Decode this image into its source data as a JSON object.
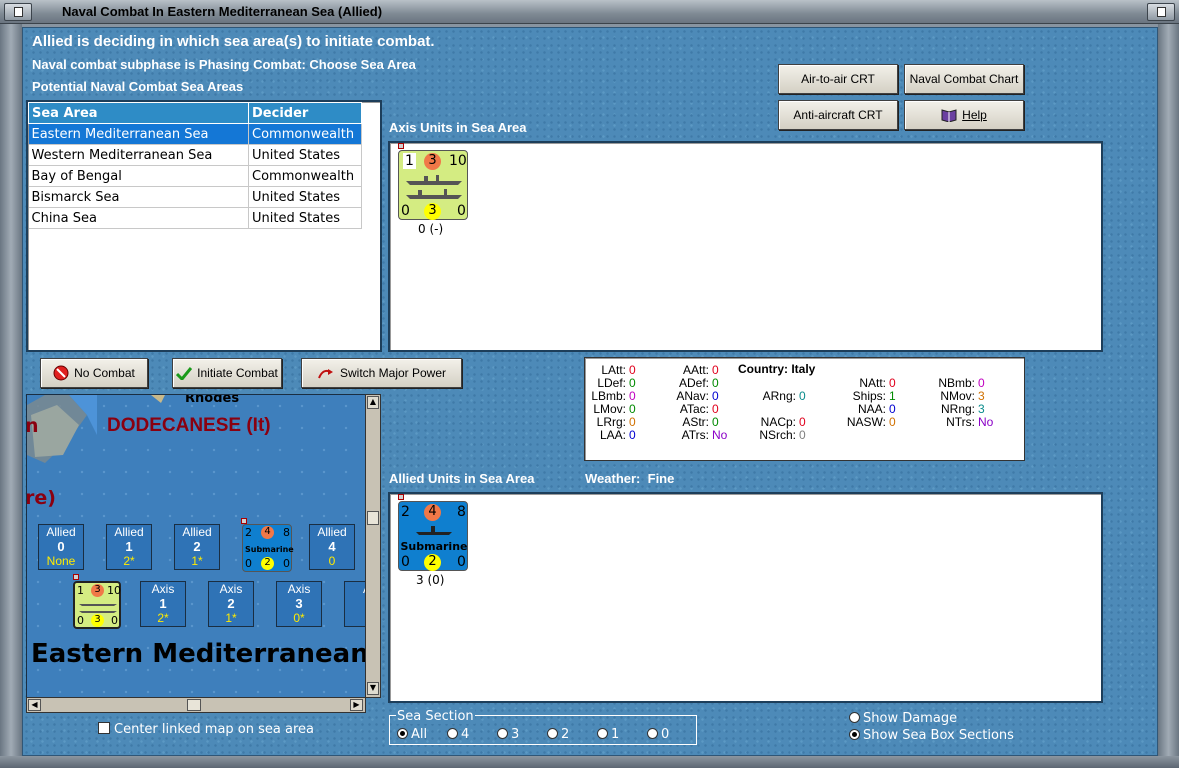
{
  "window": {
    "title": "Naval Combat In Eastern Mediterranean Sea (Allied)"
  },
  "header": {
    "line1": "Allied is deciding in which sea area(s) to initiate combat.",
    "line2": "Naval combat subphase is Phasing Combat: Choose Sea Area",
    "line3": "Potential Naval Combat Sea Areas"
  },
  "sea_table": {
    "columns": [
      "Sea Area",
      "Decider"
    ],
    "rows": [
      [
        "Eastern Mediterranean Sea",
        "Commonwealth"
      ],
      [
        "Western Mediterranean Sea",
        "United States"
      ],
      [
        "Bay of Bengal",
        "Commonwealth"
      ],
      [
        "Bismarck Sea",
        "United States"
      ],
      [
        "China Sea",
        "United States"
      ]
    ],
    "selected": 0
  },
  "buttons": {
    "air_to_air": "Air-to-air CRT",
    "naval_chart": "Naval Combat Chart",
    "anti_aircraft": "Anti-aircraft CRT",
    "help": "Help",
    "no_combat": "No Combat",
    "initiate": "Initiate Combat",
    "switch": "Switch Major Power"
  },
  "axis": {
    "label": "Axis Units in Sea Area",
    "unit": {
      "top_left": "1",
      "top_mid": "3",
      "top_right": "10",
      "bot_left": "0",
      "bot_mid": "3",
      "bot_right": "0",
      "caption": "0 (-)"
    }
  },
  "allied": {
    "label": "Allied Units in Sea Area",
    "weather_label": "Weather:",
    "weather": "Fine",
    "unit": {
      "top_left": "2",
      "top_mid": "4",
      "top_right": "8",
      "name": "Submarine",
      "bot_left": "0",
      "bot_mid": "2",
      "bot_right": "0",
      "caption": "3 (0)"
    }
  },
  "stats": {
    "country_label": "Country:",
    "country": "Italy",
    "col1": [
      [
        "LAtt:",
        "0"
      ],
      [
        "LDef:",
        "0"
      ],
      [
        "LBmb:",
        "0"
      ],
      [
        "LMov:",
        "0"
      ],
      [
        "LRrg:",
        "0"
      ],
      [
        "LAA:",
        "0"
      ]
    ],
    "col2": [
      [
        "AAtt:",
        "0"
      ],
      [
        "ADef:",
        "0"
      ],
      [
        "ANav:",
        "0"
      ],
      [
        "ATac:",
        "0"
      ],
      [
        "AStr:",
        "0"
      ],
      [
        "ATrs:",
        "No"
      ]
    ],
    "col3": [
      [
        "ARng:",
        "0"
      ],
      [
        "NACp:",
        "0"
      ],
      [
        "NSrch:",
        "0"
      ]
    ],
    "col4": [
      [
        "NAtt:",
        "0"
      ],
      [
        "Ships:",
        "1"
      ],
      [
        "NAA:",
        "0"
      ],
      [
        "NASW:",
        "0"
      ]
    ],
    "col5": [
      [
        "NBmb:",
        "0"
      ],
      [
        "NMov:",
        "3"
      ],
      [
        "NRng:",
        "3"
      ],
      [
        "NTrs:",
        "No"
      ]
    ]
  },
  "colors": {
    "zero": "#e0001c",
    "magenta": "#c000c0",
    "blue": "#0000d0",
    "green": "#008a00",
    "teal": "#0a8c8c",
    "orange": "#d07000",
    "gray": "#808080",
    "purple": "#8a00c8"
  },
  "map": {
    "region": "DODECANESE (It)",
    "island": "Rhodes",
    "partial": "re)",
    "partial_left": "n",
    "sea_name": "Eastern Mediterranean",
    "allied_boxes": [
      {
        "label": "Allied",
        "num": "0",
        "sub": "None"
      },
      {
        "label": "Allied",
        "num": "1",
        "sub": "2*"
      },
      {
        "label": "Allied",
        "num": "2",
        "sub": "1*"
      },
      {
        "label": "Allied",
        "num": "4",
        "sub": "0"
      }
    ],
    "axis_boxes": [
      {
        "label": "Axis",
        "num": "1",
        "sub": "2*"
      },
      {
        "label": "Axis",
        "num": "2",
        "sub": "1*"
      },
      {
        "label": "Axis",
        "num": "3",
        "sub": "0*"
      },
      {
        "label": "A"
      }
    ],
    "sub_counter": {
      "tl": "2",
      "tm": "4",
      "tr": "8",
      "name": "Submarine",
      "bl": "0",
      "bm": "2",
      "br": "0"
    },
    "axis_counter": {
      "tl": "1",
      "tm": "3",
      "tr": "10",
      "bl": "0",
      "bm": "3",
      "br": "0"
    }
  },
  "options": {
    "center_map": "Center linked map on sea area",
    "sea_section_label": "Sea Section",
    "sections": [
      "All",
      "4",
      "3",
      "2",
      "1",
      "0"
    ],
    "show_damage": "Show Damage",
    "show_sections": "Show Sea Box Sections"
  }
}
